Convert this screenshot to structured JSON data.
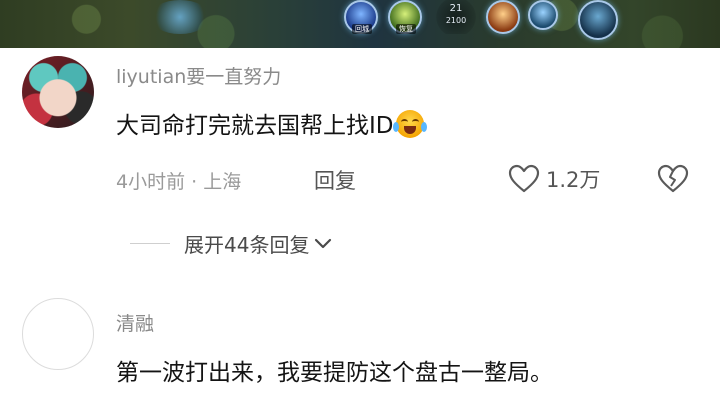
{
  "video": {
    "counter_top": "21",
    "counter_bottom": "2100",
    "skill_tags": [
      "回城",
      "恢复"
    ]
  },
  "comments": [
    {
      "username": "liyutian要一直努力",
      "text": "大司命打完就去国帮上找ID",
      "emoji": "laughing-crying-emoji",
      "time_location": "4小时前 · 上海",
      "reply_label": "回复",
      "like_count": "1.2万",
      "expand_label": "展开44条回复"
    },
    {
      "username": "清融",
      "text": "第一波打出来，我要提防这个盘古一整局。"
    }
  ],
  "icons": [
    "heart-outline-icon",
    "broken-heart-icon",
    "chevron-down-icon"
  ],
  "colors": {
    "username": "#8a8a8a",
    "meta": "#9a9a9a",
    "text": "#141414"
  }
}
